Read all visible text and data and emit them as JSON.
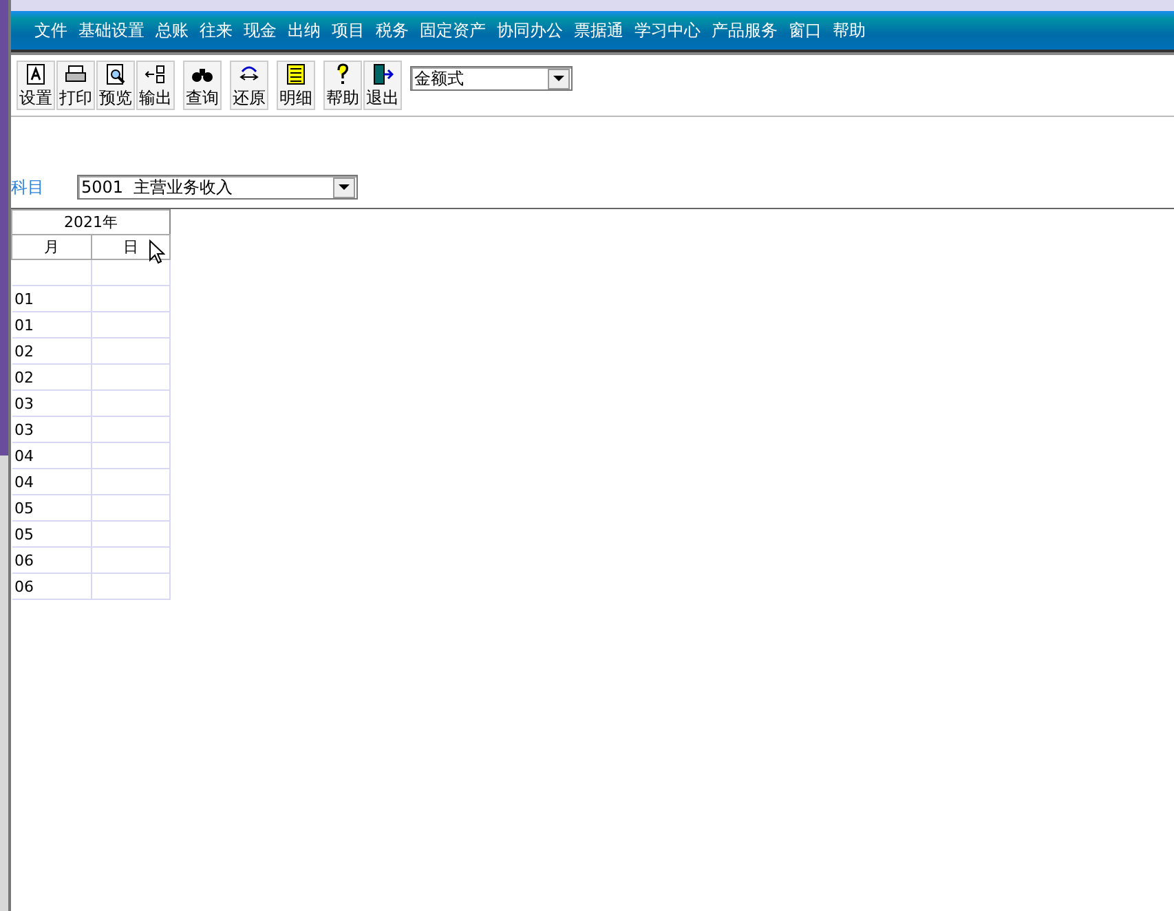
{
  "menu": [
    "文件",
    "基础设置",
    "总账",
    "往来",
    "现金",
    "出纳",
    "项目",
    "税务",
    "固定资产",
    "协同办公",
    "票据通",
    "学习中心",
    "产品服务",
    "窗口",
    "帮助"
  ],
  "toolbar": [
    {
      "label": "设置",
      "kind": "setup"
    },
    {
      "label": "打印",
      "kind": "print"
    },
    {
      "label": "预览",
      "kind": "preview"
    },
    {
      "label": "输出",
      "kind": "export"
    },
    {
      "label": "查询",
      "kind": "query"
    },
    {
      "label": "还原",
      "kind": "restore"
    },
    {
      "label": "明细",
      "kind": "detail"
    },
    {
      "label": "帮助",
      "kind": "help"
    },
    {
      "label": "退出",
      "kind": "exit"
    }
  ],
  "format_select": {
    "value": "金额式"
  },
  "subject": {
    "label": "科目",
    "value": "5001  主营业务收入"
  },
  "table": {
    "year": "2021年",
    "columns": [
      "月",
      "日"
    ],
    "rows": [
      [
        "01",
        ""
      ],
      [
        "01",
        ""
      ],
      [
        "02",
        ""
      ],
      [
        "02",
        ""
      ],
      [
        "03",
        ""
      ],
      [
        "03",
        ""
      ],
      [
        "04",
        ""
      ],
      [
        "04",
        ""
      ],
      [
        "05",
        ""
      ],
      [
        "05",
        ""
      ],
      [
        "06",
        ""
      ],
      [
        "06",
        ""
      ]
    ]
  }
}
